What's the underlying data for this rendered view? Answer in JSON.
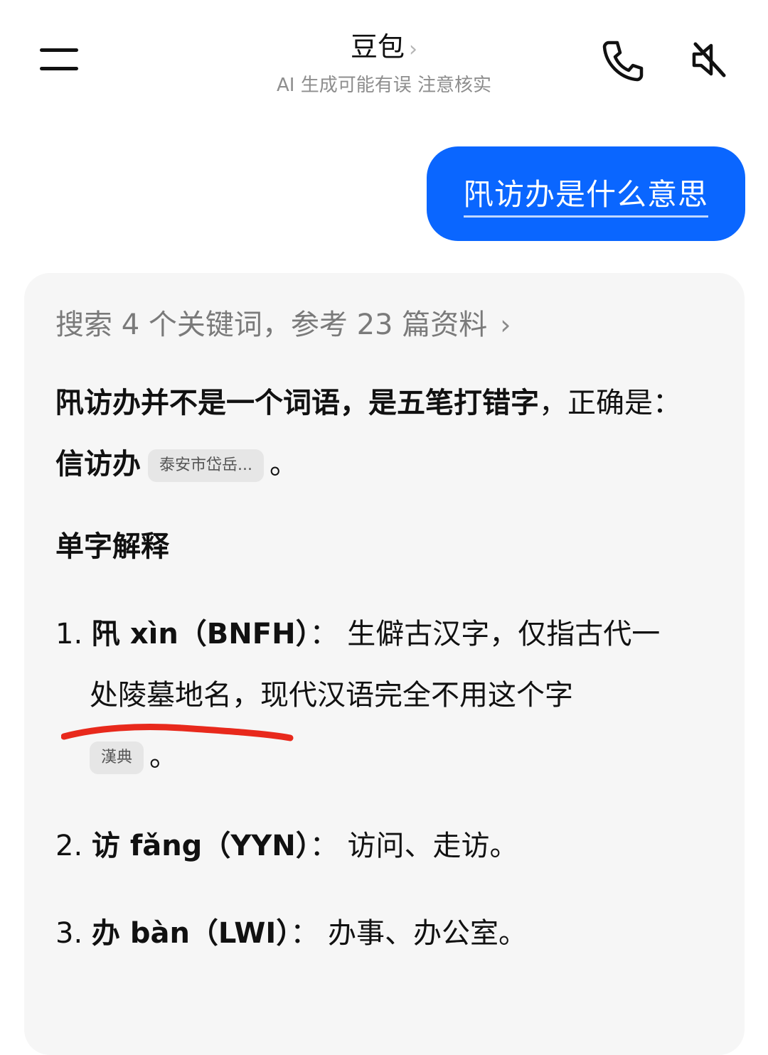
{
  "header": {
    "title": "豆包",
    "title_chevron": "›",
    "subtitle": "AI 生成可能有误 注意核实",
    "icons": [
      "menu-icon",
      "phone-icon",
      "speaker-muted-icon"
    ]
  },
  "user_message": {
    "text": "阠访办是什么意思"
  },
  "answer": {
    "search_summary": "搜索 4 个关键词，参考 23 篇资料",
    "search_chevron": "›",
    "p1_bold": "阠访办并不是一个词语，是五笔打错字",
    "p1_normal": "，正确是：",
    "p1_answer": "信访办",
    "p1_tag": "泰安市岱岳...",
    "p1_end": "。",
    "section_title": "单字解释",
    "items": [
      {
        "num": "1.",
        "head": "阠 xìn（BNFH）",
        "colon": "：",
        "text_a": "生僻古汉字，仅指古代一",
        "text_b": "处陵墓地名，现代汉语完全不用这个字",
        "tag": "漢典",
        "end": "。"
      },
      {
        "num": "2.",
        "head": "访 fǎng（YYN）",
        "colon": "：",
        "text": "访问、走访。"
      },
      {
        "num": "3.",
        "head": "办 bàn（LWI）",
        "colon": "：",
        "text": "办事、办公室。"
      }
    ]
  },
  "colors": {
    "user_bubble": "#0a66ff",
    "card_bg": "#f6f6f6",
    "underline_mark": "#e8291c"
  }
}
